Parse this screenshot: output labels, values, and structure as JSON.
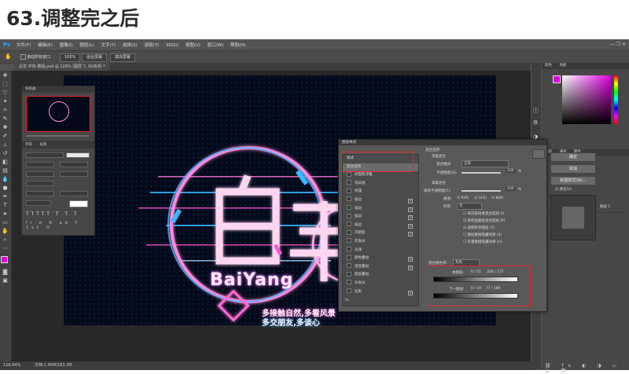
{
  "heading": "63.调整完之后",
  "app": {
    "logo": "Ps",
    "menu": [
      "文件(F)",
      "编辑(E)",
      "图像(I)",
      "图层(L)",
      "文字(Y)",
      "选择(S)",
      "滤镜(T)",
      "3D(D)",
      "视图(V)",
      "窗口(W)",
      "帮助(H)"
    ],
    "window_controls": "—  ❐  ✕"
  },
  "options": {
    "scroll_all": "滚动所有窗口",
    "zoom": "100%",
    "fit_screen": "适合屏幕",
    "fill_screen": "填充屏幕"
  },
  "document": {
    "tab_title": "白羊-字体-教程.psd @ 129% (图层 7, RGB/8) *"
  },
  "status": {
    "zoom": "128.84%",
    "doc_info": "文档:1.46M/183.2M"
  },
  "navigator": {
    "title": "导航器"
  },
  "character": {
    "tabs": [
      "字符",
      "段落"
    ]
  },
  "right_panels": {
    "color_tabs": [
      "颜色",
      "色板"
    ],
    "layer_tabs": [
      "图层",
      "通道",
      "路径"
    ],
    "layer_visible": "图层 1"
  },
  "artwork": {
    "title": "白羊",
    "name": "BaiYang",
    "subtitle_1": "多接触自然,多看风景",
    "subtitle_2": "多交朋友,多谈心"
  },
  "dialog": {
    "title": "图层样式",
    "list_header": "样式",
    "list_selected": "混合选项",
    "list_items": [
      {
        "label": "斜面和浮雕",
        "plus": false
      },
      {
        "label": "等高线",
        "plus": false
      },
      {
        "label": "纹理",
        "plus": false
      },
      {
        "label": "描边",
        "plus": true
      },
      {
        "label": "描边",
        "plus": true
      },
      {
        "label": "描边",
        "plus": true
      },
      {
        "label": "描边",
        "plus": true
      },
      {
        "label": "内阴影",
        "plus": true
      },
      {
        "label": "内发光",
        "plus": false
      },
      {
        "label": "光泽",
        "plus": false
      },
      {
        "label": "颜色叠加",
        "plus": true
      },
      {
        "label": "渐变叠加",
        "plus": true
      },
      {
        "label": "图案叠加",
        "plus": false
      },
      {
        "label": "外发光",
        "plus": false
      },
      {
        "label": "投影",
        "plus": true
      }
    ],
    "fx_label": "fx.",
    "blend_section": "混合选项",
    "general_section": "常规混合",
    "blend_mode_label": "混合模式:",
    "blend_mode_value": "正常",
    "opacity_label": "不透明度(O):",
    "opacity_value": "100",
    "percent": "%",
    "advanced_section": "高级混合",
    "fill_label": "填充不透明度(F):",
    "fill_value": "100",
    "channels_label": "通道:",
    "channels": [
      "R(R)",
      "G(G)",
      "B(B)"
    ],
    "knockout_label": "挖空:",
    "knockout_value": "无",
    "options": [
      {
        "label": "将内部效果混合成组 (I)",
        "checked": false
      },
      {
        "label": "将剪贴图层混合成组 (P)",
        "checked": true
      },
      {
        "label": "透明形状图层 (T)",
        "checked": true
      },
      {
        "label": "图层蒙版隐藏效果 (S)",
        "checked": false
      },
      {
        "label": "矢量蒙版隐藏效果 (H)",
        "checked": false
      }
    ],
    "blend_if_label": "混合颜色带:",
    "blend_if_value": "灰色",
    "this_layer_label": "本图层:",
    "this_layer_values": "0 / 55     204 / 177",
    "under_layer_label": "下一图层:",
    "under_layer_values": "0 / 19    77 / 189",
    "ok": "确定",
    "cancel": "取消",
    "new_style": "新建样式(W)...",
    "preview": "预览(V)"
  },
  "colors": {
    "accent_red": "#e8262d",
    "foreground": "#e100e1",
    "neon_pink": "#ff5ad0",
    "neon_blue": "#3ab7ff"
  }
}
